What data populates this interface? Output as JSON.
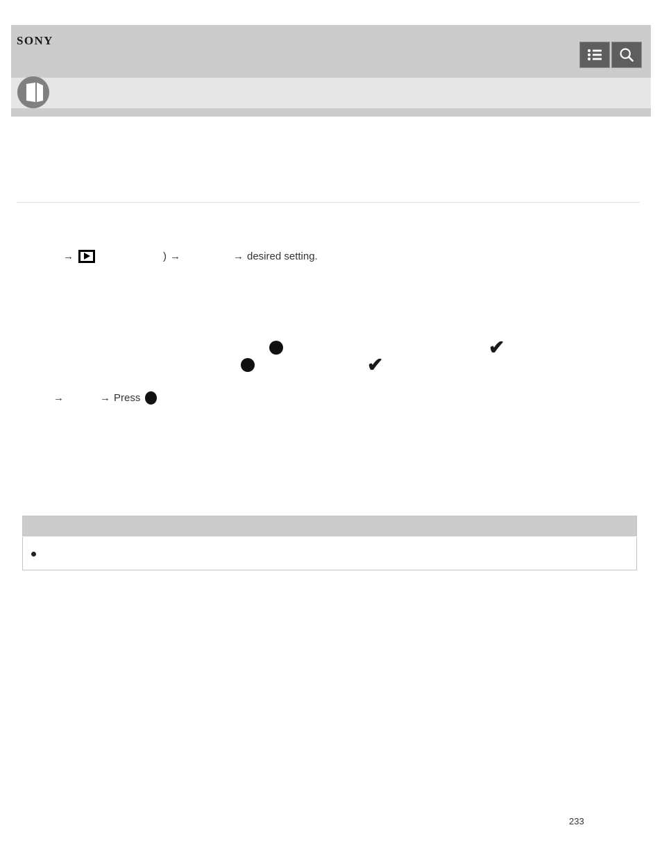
{
  "header": {
    "brand": "SONY",
    "menu_icon": "list-menu-icon",
    "search_icon": "search-icon",
    "menu_label": "",
    "search_label": ""
  },
  "breadcrumb": {
    "badge_icon": "open-book-icon",
    "text": ""
  },
  "page": {
    "title": "",
    "intro": "",
    "section_heading": "",
    "page_number": "233"
  },
  "instruction_1": {
    "arrow_1": "→",
    "playback_icon": "playback-mode-icon",
    "blank_a": "",
    "paren": ")",
    "arrow_2": "→",
    "blank_b": "",
    "arrow_3": "→",
    "tail": "desired setting."
  },
  "instruction_2": {
    "blank_c": "",
    "arrow_1": "→",
    "blank_d": "",
    "arrow_2": "→",
    "press_label": "Press",
    "press_icon": "center-button-dot-icon"
  },
  "body": {
    "para_a": "",
    "para_b": "",
    "para_c": ""
  },
  "marks": {
    "dot_1": "center-button-dot-icon",
    "dot_2": "center-button-dot-icon",
    "check_1": "checkmark-icon",
    "check_2": "checkmark-icon",
    "check_glyph": "✔"
  },
  "table": {
    "header_cell": "",
    "body_bullet_icon": "bullet-icon",
    "body_cell": ""
  },
  "colors": {
    "header_band": "#cccccc",
    "breadcrumb_band": "#e6e6e6",
    "button_fill": "#5e5e5e",
    "table_header": "#cccccc",
    "divider": "#e0e0e0",
    "text": "#333333"
  }
}
